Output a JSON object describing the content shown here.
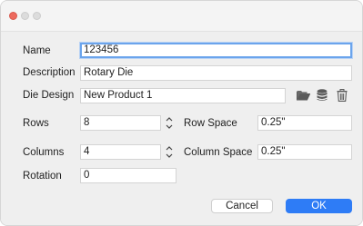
{
  "form": {
    "name": {
      "label": "Name",
      "value": "123456"
    },
    "description": {
      "label": "Description",
      "value": "Rotary Die"
    },
    "die_design": {
      "label": "Die Design",
      "value": "New Product 1"
    },
    "rows": {
      "label": "Rows",
      "value": "8"
    },
    "row_space": {
      "label": "Row Space",
      "value": "0.25\""
    },
    "columns": {
      "label": "Columns",
      "value": "4"
    },
    "column_space": {
      "label": "Column Space",
      "value": "0.25\""
    },
    "rotation": {
      "label": "Rotation",
      "value": "0"
    }
  },
  "icons": {
    "open": "folder-open-icon",
    "database": "database-icon",
    "delete": "trash-icon",
    "stepper": "up-down-stepper-icon"
  },
  "buttons": {
    "cancel": "Cancel",
    "ok": "OK"
  },
  "colors": {
    "close_button": "#ed6a5e",
    "focus_ring": "#6ba4ec",
    "ok_button": "#2e7cf6"
  }
}
